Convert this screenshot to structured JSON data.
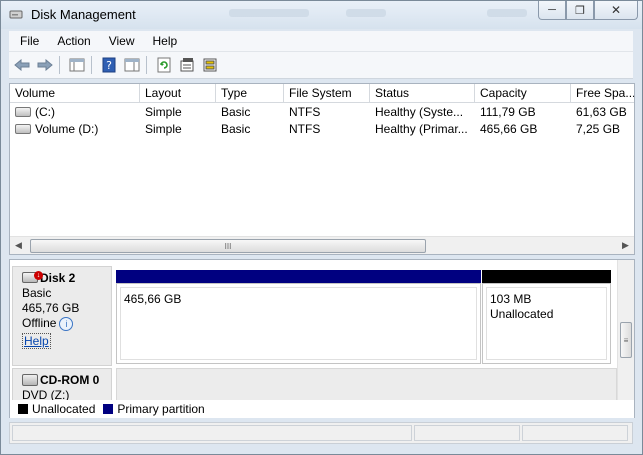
{
  "window": {
    "title": "Disk Management"
  },
  "menu": {
    "items": [
      "File",
      "Action",
      "View",
      "Help"
    ]
  },
  "toolbar": {
    "icons": [
      "back-arrow-icon",
      "forward-arrow-icon",
      "console-tree-icon",
      "help-icon",
      "properties-pane-icon",
      "refresh-icon",
      "properties-icon",
      "rescan-disks-icon"
    ]
  },
  "volume_list": {
    "columns": [
      "Volume",
      "Layout",
      "Type",
      "File System",
      "Status",
      "Capacity",
      "Free Spa..."
    ],
    "rows": [
      [
        "(C:)",
        "Simple",
        "Basic",
        "NTFS",
        "Healthy (Syste...",
        "111,79 GB",
        "61,63 GB"
      ],
      [
        "Volume (D:)",
        "Simple",
        "Basic",
        "NTFS",
        "Healthy (Primar...",
        "465,66 GB",
        "7,25 GB"
      ]
    ]
  },
  "disk2": {
    "name": "Disk 2",
    "type": "Basic",
    "size": "465,76 GB",
    "state": "Offline",
    "help": "Help",
    "partitions": [
      {
        "size": "465,66 GB",
        "label": "",
        "color": "#000080"
      },
      {
        "size": "103 MB",
        "label": "Unallocated",
        "color": "#000000"
      }
    ]
  },
  "cdrom0": {
    "name": "CD-ROM 0",
    "drive": "DVD (Z:)"
  },
  "legend": [
    {
      "label": "Unallocated",
      "color": "#000000"
    },
    {
      "label": "Primary partition",
      "color": "#000080"
    }
  ],
  "scrollbar_grip": "III",
  "vscroll_grip": "≡"
}
